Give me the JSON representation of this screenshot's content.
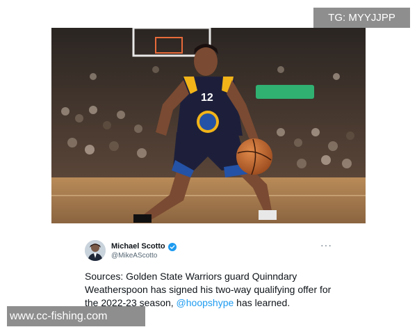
{
  "photo": {
    "alt_subject": "basketball-player-photo",
    "jersey_number": "12"
  },
  "tweet": {
    "display_name": "Michael Scotto",
    "handle": "@MikeAScotto",
    "more_label": "···",
    "text_before": "Sources: Golden State Warriors guard Quinndary Weatherspoon has signed his two-way qualifying offer for the 2022-23 season, ",
    "mention": "@hoopshype",
    "text_after": " has learned."
  },
  "watermarks": {
    "top": "TG: MYYJJPP",
    "bottom": "www.cc-fishing.com"
  },
  "colors": {
    "link": "#1d9bf0",
    "verified": "#1d9bf0",
    "jersey_navy": "#1d1f3a",
    "jersey_gold": "#f2b418",
    "shorts_blue": "#2452a6"
  }
}
